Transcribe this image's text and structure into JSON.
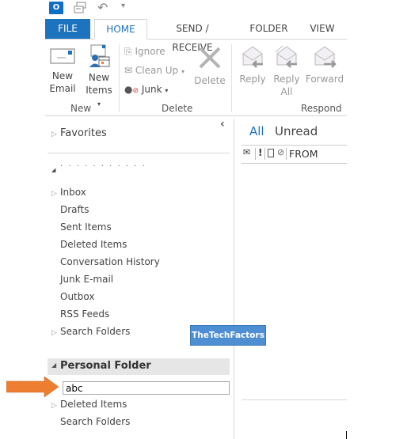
{
  "quick_access": {
    "outlook_icon": "outlook-icon",
    "sync_icon": "send-receive-all-icon",
    "undo_icon": "undo-icon",
    "customize_icon": "customize-toolbar-icon",
    "outlook_glyph": "O"
  },
  "tabs": [
    {
      "label": "FILE"
    },
    {
      "label": "HOME"
    },
    {
      "label": "SEND / RECEIVE"
    },
    {
      "label": "FOLDER"
    },
    {
      "label": "VIEW"
    }
  ],
  "ribbon": {
    "groups": {
      "new": {
        "label": "New"
      },
      "delete": {
        "label": "Delete"
      },
      "respond": {
        "label": "Respond"
      }
    },
    "new_email": {
      "line1": "New",
      "line2": "Email"
    },
    "new_items": {
      "line1": "New",
      "line2": "Items",
      "caret": "▾"
    },
    "ignore": "Ignore",
    "clean_up": "Clean Up",
    "clean_up_caret": "▾",
    "junk": "Junk",
    "junk_caret": "▾",
    "delete": "Delete",
    "reply": "Reply",
    "reply_all": {
      "line1": "Reply",
      "line2": "All"
    },
    "forward": "Forward"
  },
  "folder_pane": {
    "collapse_glyph": "‹",
    "favorites": "Favorites",
    "account_blurred": "· · · · · · · · · · ·",
    "mailbox_items": [
      {
        "label": "Inbox",
        "expandable": true
      },
      {
        "label": "Drafts",
        "expandable": false
      },
      {
        "label": "Sent Items",
        "expandable": false
      },
      {
        "label": "Deleted Items",
        "expandable": false
      },
      {
        "label": "Conversation History",
        "expandable": false
      },
      {
        "label": "Junk E-mail",
        "expandable": false
      },
      {
        "label": "Outbox",
        "expandable": false
      },
      {
        "label": "RSS Feeds",
        "expandable": false
      },
      {
        "label": "Search Folders",
        "expandable": true
      }
    ],
    "personal_folder": {
      "title": "Personal Folder",
      "new_folder_input_value": "abc",
      "items": [
        {
          "label": "Deleted Items",
          "expandable": true
        },
        {
          "label": "Search Folders",
          "expandable": false
        }
      ]
    }
  },
  "message_list": {
    "filter_all": "All",
    "filter_unread": "Unread",
    "column_from": "FROM",
    "col_importance": "!"
  },
  "watermark": "TheTechFactors",
  "colors": {
    "accent": "#1e73be",
    "annotation_arrow": "#ed7d31",
    "watermark_bg": "#4e8fd4"
  }
}
